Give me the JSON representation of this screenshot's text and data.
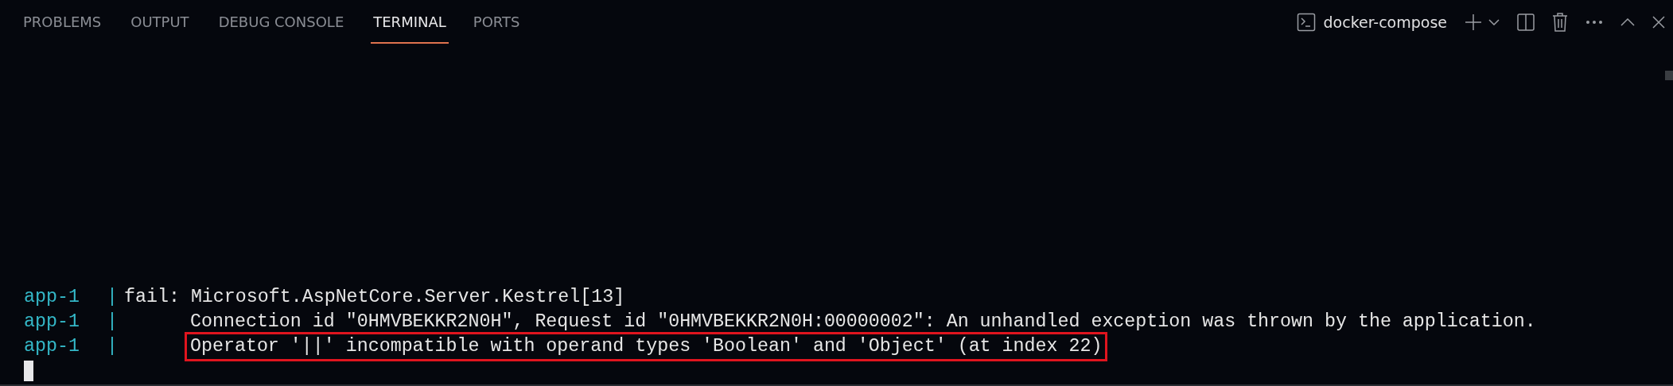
{
  "tabs": [
    {
      "label": "PROBLEMS",
      "selected": false
    },
    {
      "label": "OUTPUT",
      "selected": false
    },
    {
      "label": "DEBUG CONSOLE",
      "selected": false
    },
    {
      "label": "TERMINAL",
      "selected": true
    },
    {
      "label": "PORTS",
      "selected": false
    }
  ],
  "terminal_picker": {
    "label": "docker-compose"
  },
  "terminal": {
    "lines": [
      {
        "service": "app-1",
        "separator": "|",
        "indent": false,
        "text": "fail: Microsoft.AspNetCore.Server.Kestrel[13]",
        "highlighted": false
      },
      {
        "service": "app-1",
        "separator": "|",
        "indent": true,
        "text": "Connection id \"0HMVBEKKR2N0H\", Request id \"0HMVBEKKR2N0H:00000002\": An unhandled exception was thrown by the application.",
        "highlighted": false
      },
      {
        "service": "app-1",
        "separator": "|",
        "indent": true,
        "text": "Operator '||' incompatible with operand types 'Boolean' and 'Object' (at index 22)",
        "highlighted": true
      }
    ]
  }
}
